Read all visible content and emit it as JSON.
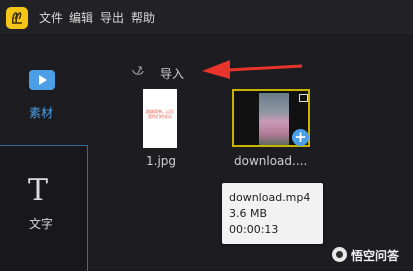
{
  "menubar": {
    "items": [
      "文件",
      "编辑",
      "导出",
      "帮助"
    ]
  },
  "sidebar": {
    "media_label": "素材",
    "text_label": "文字",
    "text_icon_glyph": "T"
  },
  "content": {
    "import_label": "导入",
    "items": [
      {
        "name": "1.jpg",
        "thumb_text": "超级简单，以后是你们的导出"
      },
      {
        "name": "download...."
      }
    ],
    "tooltip": {
      "filename": "download.mp4",
      "size": "3.6 MB",
      "duration": "00:00:13"
    }
  },
  "watermark": {
    "text": "悟空问答"
  },
  "colors": {
    "accent": "#4a9fe8",
    "selection_border": "#c8b400",
    "arrow": "#e8342a",
    "logo": "#f5c518"
  }
}
